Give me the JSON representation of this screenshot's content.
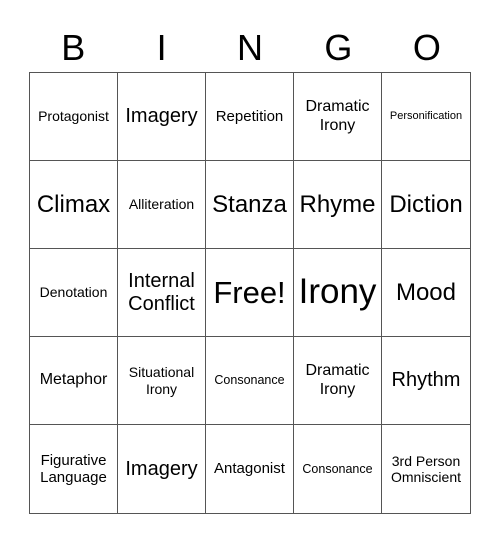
{
  "header": [
    "B",
    "I",
    "N",
    "G",
    "O"
  ],
  "cells": [
    {
      "text": "Protagonist",
      "size": "s14"
    },
    {
      "text": "Imagery",
      "size": "s20"
    },
    {
      "text": "Repetition",
      "size": "s15"
    },
    {
      "text": "Dramatic Irony",
      "size": "s16"
    },
    {
      "text": "Personification",
      "size": "s10"
    },
    {
      "text": "Climax",
      "size": "s24"
    },
    {
      "text": "Alliteration",
      "size": "s14"
    },
    {
      "text": "Stanza",
      "size": "s24"
    },
    {
      "text": "Rhyme",
      "size": "s24"
    },
    {
      "text": "Diction",
      "size": "s24"
    },
    {
      "text": "Denotation",
      "size": "s14"
    },
    {
      "text": "Internal Conflict",
      "size": "s20"
    },
    {
      "text": "Free!",
      "size": "s32"
    },
    {
      "text": "Irony",
      "size": "s36"
    },
    {
      "text": "Mood",
      "size": "s24"
    },
    {
      "text": "Metaphor",
      "size": "s16"
    },
    {
      "text": "Situational Irony",
      "size": "s14"
    },
    {
      "text": "Consonance",
      "size": "s12"
    },
    {
      "text": "Dramatic Irony",
      "size": "s16"
    },
    {
      "text": "Rhythm",
      "size": "s20"
    },
    {
      "text": "Figurative Language",
      "size": "s15"
    },
    {
      "text": "Imagery",
      "size": "s20"
    },
    {
      "text": "Antagonist",
      "size": "s15"
    },
    {
      "text": "Consonance",
      "size": "s12"
    },
    {
      "text": "3rd Person Omniscient",
      "size": "s14"
    }
  ]
}
